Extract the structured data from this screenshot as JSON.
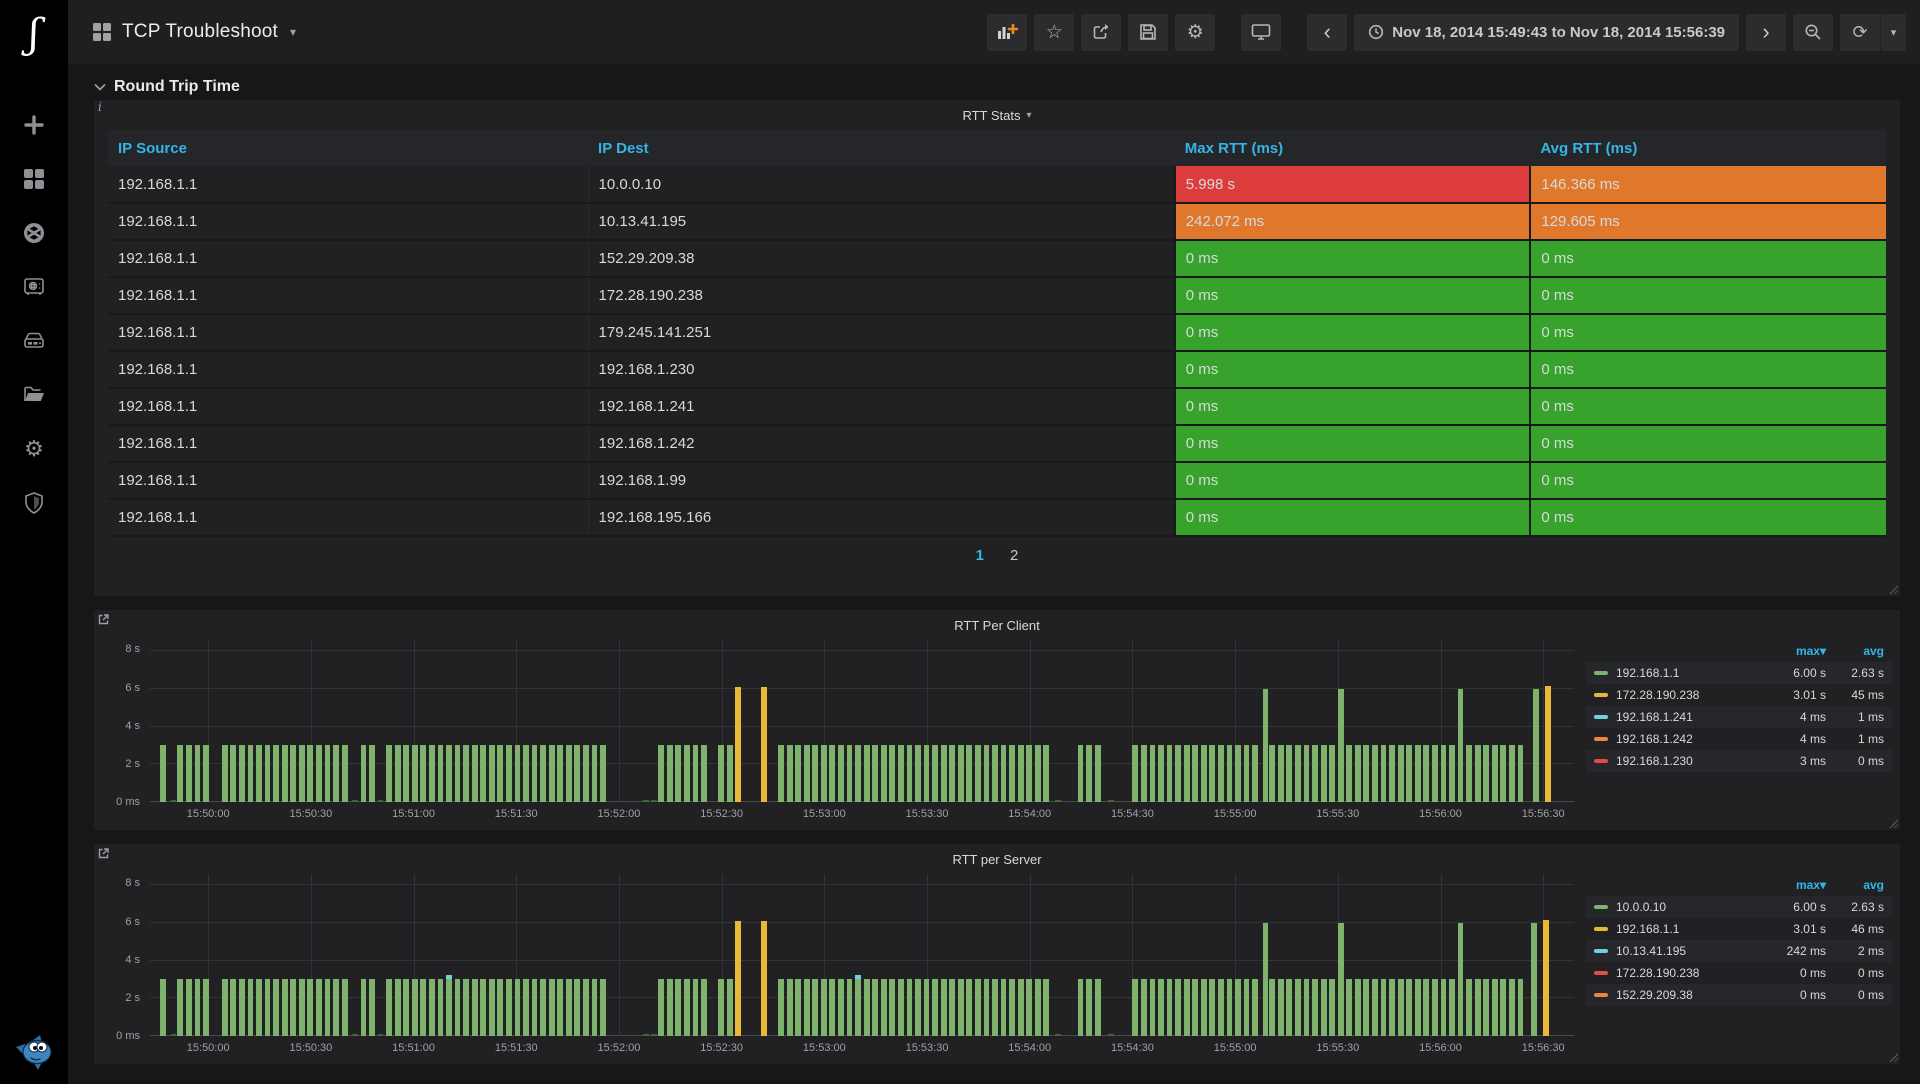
{
  "colors": {
    "accent_blue": "#33b5e5",
    "cell_red": "#dd3c3c",
    "cell_orange": "#e0782c",
    "cell_green": "#37a32d",
    "bar_green": "#7eb26d",
    "bar_yellow": "#eab839",
    "bar_blue": "#6ed0e0",
    "bar_orange": "#ef843c",
    "bar_red": "#e24d42",
    "bar_stub": "#3f6833"
  },
  "icons": {
    "glyphs": {
      "star": "☆",
      "gear": "⚙",
      "refresh": "⟳",
      "caret": "▾",
      "chevron_left": "‹",
      "chevron_right": "›",
      "info": "i",
      "logo": "ʃ"
    }
  },
  "navbar": {
    "title": "TCP Troubleshoot",
    "time_range": "Nov 18, 2014 15:49:43 to Nov 18, 2014 15:56:39"
  },
  "section": {
    "title": "Round Trip Time"
  },
  "table_panel": {
    "title": "RTT Stats",
    "columns": [
      "IP Source",
      "IP Dest",
      "Max RTT (ms)",
      "Avg RTT (ms)"
    ],
    "rows": [
      {
        "src": "192.168.1.1",
        "dest": "10.0.0.10",
        "max": {
          "text": "5.998 s",
          "color": "cell_red"
        },
        "avg": {
          "text": "146.366 ms",
          "color": "cell_orange"
        }
      },
      {
        "src": "192.168.1.1",
        "dest": "10.13.41.195",
        "max": {
          "text": "242.072 ms",
          "color": "cell_orange"
        },
        "avg": {
          "text": "129.605 ms",
          "color": "cell_orange"
        }
      },
      {
        "src": "192.168.1.1",
        "dest": "152.29.209.38",
        "max": {
          "text": "0 ms",
          "color": "cell_green"
        },
        "avg": {
          "text": "0 ms",
          "color": "cell_green"
        }
      },
      {
        "src": "192.168.1.1",
        "dest": "172.28.190.238",
        "max": {
          "text": "0 ms",
          "color": "cell_green"
        },
        "avg": {
          "text": "0 ms",
          "color": "cell_green"
        }
      },
      {
        "src": "192.168.1.1",
        "dest": "179.245.141.251",
        "max": {
          "text": "0 ms",
          "color": "cell_green"
        },
        "avg": {
          "text": "0 ms",
          "color": "cell_green"
        }
      },
      {
        "src": "192.168.1.1",
        "dest": "192.168.1.230",
        "max": {
          "text": "0 ms",
          "color": "cell_green"
        },
        "avg": {
          "text": "0 ms",
          "color": "cell_green"
        }
      },
      {
        "src": "192.168.1.1",
        "dest": "192.168.1.241",
        "max": {
          "text": "0 ms",
          "color": "cell_green"
        },
        "avg": {
          "text": "0 ms",
          "color": "cell_green"
        }
      },
      {
        "src": "192.168.1.1",
        "dest": "192.168.1.242",
        "max": {
          "text": "0 ms",
          "color": "cell_green"
        },
        "avg": {
          "text": "0 ms",
          "color": "cell_green"
        }
      },
      {
        "src": "192.168.1.1",
        "dest": "192.168.1.99",
        "max": {
          "text": "0 ms",
          "color": "cell_green"
        },
        "avg": {
          "text": "0 ms",
          "color": "cell_green"
        }
      },
      {
        "src": "192.168.1.1",
        "dest": "192.168.195.166",
        "max": {
          "text": "0 ms",
          "color": "cell_green"
        },
        "avg": {
          "text": "0 ms",
          "color": "cell_green"
        }
      }
    ],
    "pages": [
      "1",
      "2"
    ],
    "active_page": "1"
  },
  "chart_data": [
    {
      "type": "bar",
      "title": "RTT Per Client",
      "t0": "15:49:43",
      "t1": "15:56:39",
      "duration_s": 416,
      "ylim": [
        0,
        8.6
      ],
      "grid": true,
      "legend_position": "right",
      "y_ticks": [
        {
          "v": 8,
          "label": "8 s"
        },
        {
          "v": 6,
          "label": "6 s"
        },
        {
          "v": 4,
          "label": "4 s"
        },
        {
          "v": 2,
          "label": "2 s"
        },
        {
          "v": 0,
          "label": "0 ms"
        }
      ],
      "x_ticks": [
        "15:50:00",
        "15:50:30",
        "15:51:00",
        "15:51:30",
        "15:52:00",
        "15:52:30",
        "15:53:00",
        "15:53:30",
        "15:54:00",
        "15:54:30",
        "15:55:00",
        "15:55:30",
        "15:56:00",
        "15:56:30"
      ],
      "bar_step_s": 2.5,
      "base_value_s": 3.01,
      "base_color": "bar_green",
      "runs": [
        [
          3,
          3
        ],
        [
          8,
          16
        ],
        [
          21,
          56
        ],
        [
          61.5,
          64
        ],
        [
          69,
          131.5
        ],
        [
          148.5,
          161
        ],
        [
          166,
          168.5
        ],
        [
          183.5,
          262
        ],
        [
          271,
          276
        ],
        [
          287,
          401
        ]
      ],
      "spikes": [
        {
          "t": 171,
          "v": 6.1,
          "color": "bar_yellow"
        },
        {
          "t": 178.5,
          "v": 6.1,
          "color": "bar_yellow"
        },
        {
          "t": 325,
          "v": 6.0,
          "color": "bar_green"
        },
        {
          "t": 347,
          "v": 6.0,
          "color": "bar_green"
        },
        {
          "t": 382,
          "v": 6.0,
          "color": "bar_green"
        },
        {
          "t": 404,
          "v": 6.0,
          "color": "bar_green"
        },
        {
          "t": 407.5,
          "v": 6.15,
          "color": "bar_yellow"
        }
      ],
      "caps": [],
      "stubs": [
        6,
        59,
        66.5,
        144,
        146.5,
        264.5,
        280
      ],
      "legend": {
        "headers": [
          "max",
          "avg"
        ],
        "sorted": "max",
        "series": [
          {
            "name": "192.168.1.1",
            "color": "bar_green",
            "max": "6.00 s",
            "avg": "2.63 s"
          },
          {
            "name": "172.28.190.238",
            "color": "bar_yellow",
            "max": "3.01 s",
            "avg": "45 ms"
          },
          {
            "name": "192.168.1.241",
            "color": "bar_blue",
            "max": "4 ms",
            "avg": "1 ms"
          },
          {
            "name": "192.168.1.242",
            "color": "bar_orange",
            "max": "4 ms",
            "avg": "1 ms"
          },
          {
            "name": "192.168.1.230",
            "color": "bar_red",
            "max": "3 ms",
            "avg": "0 ms"
          }
        ]
      }
    },
    {
      "type": "bar",
      "title": "RTT per Server",
      "t0": "15:49:43",
      "t1": "15:56:39",
      "duration_s": 416,
      "ylim": [
        0,
        8.6
      ],
      "grid": true,
      "legend_position": "right",
      "y_ticks": [
        {
          "v": 8,
          "label": "8 s"
        },
        {
          "v": 6,
          "label": "6 s"
        },
        {
          "v": 4,
          "label": "4 s"
        },
        {
          "v": 2,
          "label": "2 s"
        },
        {
          "v": 0,
          "label": "0 ms"
        }
      ],
      "x_ticks": [
        "15:50:00",
        "15:50:30",
        "15:51:00",
        "15:51:30",
        "15:52:00",
        "15:52:30",
        "15:53:00",
        "15:53:30",
        "15:54:00",
        "15:54:30",
        "15:55:00",
        "15:55:30",
        "15:56:00",
        "15:56:30"
      ],
      "bar_step_s": 2.5,
      "base_value_s": 3.01,
      "base_color": "bar_green",
      "runs": [
        [
          3,
          3
        ],
        [
          8,
          16
        ],
        [
          21,
          56
        ],
        [
          61.5,
          64
        ],
        [
          69,
          131.5
        ],
        [
          148.5,
          161
        ],
        [
          166,
          168.5
        ],
        [
          183.5,
          262
        ],
        [
          271,
          276
        ],
        [
          287,
          401
        ]
      ],
      "spikes": [
        {
          "t": 171,
          "v": 6.1,
          "color": "bar_yellow"
        },
        {
          "t": 178.5,
          "v": 6.1,
          "color": "bar_yellow"
        },
        {
          "t": 325,
          "v": 6.0,
          "color": "bar_green"
        },
        {
          "t": 347,
          "v": 6.0,
          "color": "bar_green"
        },
        {
          "t": 382,
          "v": 6.0,
          "color": "bar_green"
        },
        {
          "t": 403.5,
          "v": 6.0,
          "color": "bar_green"
        },
        {
          "t": 407,
          "v": 6.15,
          "color": "bar_yellow"
        }
      ],
      "caps": [
        {
          "t": 86.5,
          "v": 0.25,
          "color": "bar_blue"
        },
        {
          "t": 206,
          "v": 0.25,
          "color": "bar_blue"
        }
      ],
      "stubs": [
        6,
        59,
        66.5,
        144,
        146.5,
        264.5,
        280
      ],
      "legend": {
        "headers": [
          "max",
          "avg"
        ],
        "sorted": "max",
        "series": [
          {
            "name": "10.0.0.10",
            "color": "bar_green",
            "max": "6.00 s",
            "avg": "2.63 s"
          },
          {
            "name": "192.168.1.1",
            "color": "bar_yellow",
            "max": "3.01 s",
            "avg": "46 ms"
          },
          {
            "name": "10.13.41.195",
            "color": "bar_blue",
            "max": "242 ms",
            "avg": "2 ms"
          },
          {
            "name": "172.28.190.238",
            "color": "bar_red",
            "max": "0 ms",
            "avg": "0 ms"
          },
          {
            "name": "152.29.209.38",
            "color": "bar_orange",
            "max": "0 ms",
            "avg": "0 ms"
          }
        ]
      }
    }
  ]
}
